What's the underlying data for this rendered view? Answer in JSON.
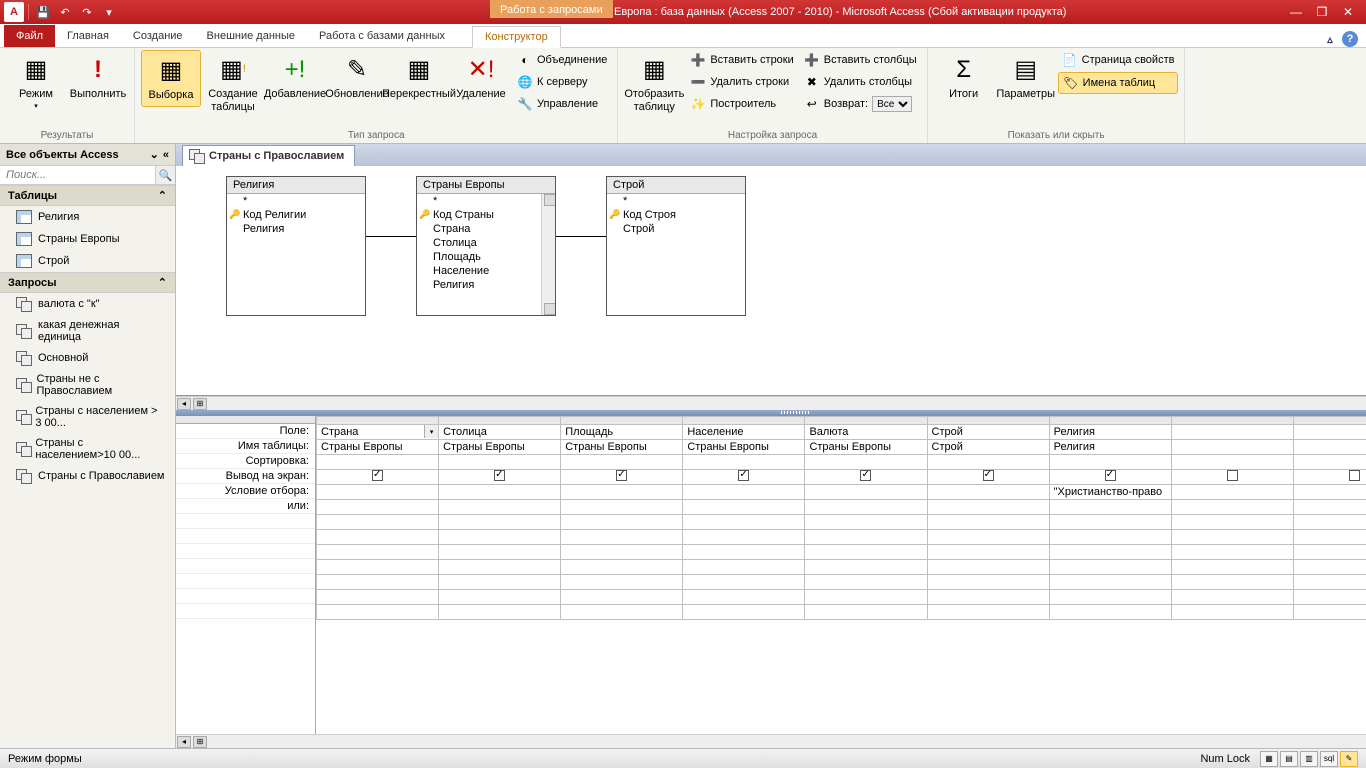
{
  "title": {
    "context_tab": "Работа с запросами",
    "text": "Европа : база данных (Access 2007 - 2010)  -  Microsoft Access (Сбой активации продукта)"
  },
  "tabs": {
    "file": "Файл",
    "home": "Главная",
    "create": "Создание",
    "external": "Внешние данные",
    "dbtools": "Работа с базами данных",
    "design": "Конструктор"
  },
  "ribbon": {
    "results": {
      "view": "Режим",
      "run": "Выполнить",
      "group": "Результаты"
    },
    "qtype": {
      "select": "Выборка",
      "maketable": "Создание таблицы",
      "append": "Добавление",
      "update": "Обновление",
      "crosstab": "Перекрестный",
      "delete": "Удаление",
      "union": "Объединение",
      "passthrough": "К серверу",
      "datadef": "Управление",
      "group": "Тип запроса"
    },
    "setup": {
      "showtable": "Отобразить таблицу",
      "insertrows": "Вставить строки",
      "deleterows": "Удалить строки",
      "builder": "Построитель",
      "insertcols": "Вставить столбцы",
      "deletecols": "Удалить столбцы",
      "return": "Возврат:",
      "return_val": "Все",
      "group": "Настройка запроса"
    },
    "showhide": {
      "totals": "Итоги",
      "params": "Параметры",
      "propsheet": "Страница свойств",
      "tablenames": "Имена таблиц",
      "group": "Показать или скрыть"
    }
  },
  "nav": {
    "header": "Все объекты Access",
    "search_placeholder": "Поиск...",
    "tables_group": "Таблицы",
    "tables": [
      "Религия",
      "Страны Европы",
      "Строй"
    ],
    "queries_group": "Запросы",
    "queries": [
      "валюта с \"к\"",
      "какая денежная единица",
      "Основной",
      "Страны не с Православием",
      "Страны с населением > 3 00...",
      "Страны с населением>10 00...",
      "Страны с Православием"
    ]
  },
  "doc": {
    "tab": "Страны с Православием"
  },
  "tables": {
    "t1": {
      "title": "Религия",
      "fields_star": "*",
      "pk": "Код Религии",
      "f1": "Религия"
    },
    "t2": {
      "title": "Страны Европы",
      "fields_star": "*",
      "pk": "Код Страны",
      "f1": "Страна",
      "f2": "Столица",
      "f3": "Площадь",
      "f4": "Население",
      "f5": "Религия"
    },
    "t3": {
      "title": "Строй",
      "fields_star": "*",
      "pk": "Код Строя",
      "f1": "Строй"
    }
  },
  "gridlabels": {
    "field": "Поле:",
    "table": "Имя таблицы:",
    "sort": "Сортировка:",
    "show": "Вывод на экран:",
    "criteria": "Условие отбора:",
    "or": "или:"
  },
  "grid": {
    "cols": [
      {
        "field": "Страна",
        "table": "Страны Европы",
        "show": true,
        "criteria": ""
      },
      {
        "field": "Столица",
        "table": "Страны Европы",
        "show": true,
        "criteria": ""
      },
      {
        "field": "Площадь",
        "table": "Страны Европы",
        "show": true,
        "criteria": ""
      },
      {
        "field": "Население",
        "table": "Страны Европы",
        "show": true,
        "criteria": ""
      },
      {
        "field": "Валюта",
        "table": "Страны Европы",
        "show": true,
        "criteria": ""
      },
      {
        "field": "Строй",
        "table": "Строй",
        "show": true,
        "criteria": ""
      },
      {
        "field": "Религия",
        "table": "Религия",
        "show": true,
        "criteria": "\"Христианство-право"
      },
      {
        "field": "",
        "table": "",
        "show": false,
        "criteria": ""
      },
      {
        "field": "",
        "table": "",
        "show": false,
        "criteria": ""
      }
    ]
  },
  "status": {
    "mode": "Режим формы",
    "numlock": "Num Lock"
  }
}
